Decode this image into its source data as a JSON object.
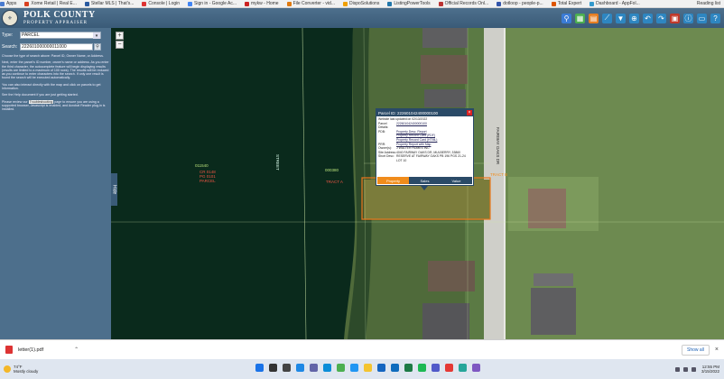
{
  "bookmarks": [
    {
      "label": "Apps",
      "color": "#4a7bd0"
    },
    {
      "label": "Xome Retail | Real E...",
      "color": "#d94020"
    },
    {
      "label": "Stellar MLS | That's...",
      "color": "#2a5aa0"
    },
    {
      "label": "Console | Login",
      "color": "#d33"
    },
    {
      "label": "Sign in - Google Ac...",
      "color": "#4285f4"
    },
    {
      "label": "mykw - Home",
      "color": "#c22"
    },
    {
      "label": "File Converter - vid...",
      "color": "#e07a10"
    },
    {
      "label": "DispoSolutions",
      "color": "#f0a000"
    },
    {
      "label": "ListingPowerTools",
      "color": "#27a"
    },
    {
      "label": "Official Records Onl...",
      "color": "#b33"
    },
    {
      "label": "dotloop - people-p...",
      "color": "#35a"
    },
    {
      "label": "Total Expert",
      "color": "#d50"
    },
    {
      "label": "Dashboard - AppFol...",
      "color": "#39c"
    }
  ],
  "reading_list": "Reading list",
  "header": {
    "title": "POLK COUNTY",
    "subtitle": "PROPERTY APPRAISER"
  },
  "toolbar_icons": [
    {
      "name": "binoculars-icon",
      "glyph": "⚲",
      "color": "#3a7bd5"
    },
    {
      "name": "grid-icon",
      "glyph": "▦",
      "color": "#4caf50"
    },
    {
      "name": "layers-icon",
      "glyph": "▤",
      "color": "#e67e22"
    },
    {
      "name": "measure-icon",
      "glyph": "⟋",
      "color": "#2e86c1"
    },
    {
      "name": "filter-icon",
      "glyph": "▼",
      "color": "#2e86c1"
    },
    {
      "name": "zoom-icon",
      "glyph": "⊕",
      "color": "#2e86c1"
    },
    {
      "name": "back-icon",
      "glyph": "↶",
      "color": "#2e86c1"
    },
    {
      "name": "forward-icon",
      "glyph": "↷",
      "color": "#2e86c1"
    },
    {
      "name": "print-icon",
      "glyph": "▣",
      "color": "#c0392b"
    },
    {
      "name": "info-icon",
      "glyph": "ⓘ",
      "color": "#2e86c1"
    },
    {
      "name": "export-icon",
      "glyph": "▭",
      "color": "#2e86c1"
    },
    {
      "name": "help-icon",
      "glyph": "?",
      "color": "#2e86c1"
    }
  ],
  "sidebar": {
    "type_label": "Type:",
    "type_value": "PARCEL",
    "search_label": "Search:",
    "search_value": "222601000000011000",
    "help_texts": [
      "Choose the type of search above: Parcel ID, Owner Name, or Address.",
      "Next, enter the parcel's ID number, owner's name or address. As you enter the third character, the autocomplete feature will begin displaying results (results are limited to a maximum of 100 rows). The results will be reduced as you continue to enter characters into the search. If only one result is found the search will be executed automatically.",
      "You can also interact directly with the map and click on parcels to get information.",
      "See the Help document if you are just getting started."
    ],
    "tshoot_prefix": "Please review our",
    "tshoot_link": "Troubleshooting",
    "tshoot_suffix": "page to ensure you are using a supported browser, Javascript is enabled, and Acrobat Reader plug-in is installed."
  },
  "hide_label": "Hide",
  "map_labels": {
    "parcel_a": "011540",
    "parcel_b": "000380",
    "red_a1": "CR 0148",
    "red_a2": "PG 0101",
    "red_a3": "PARCEL",
    "red_b": "TRACT A",
    "red_c": "TRACT B",
    "street_a": "STREET",
    "street_b": "FAIRWAY OAKS DR"
  },
  "popup": {
    "title": "Parcel ID: 222601042400000100",
    "updated": "Website last updated on 02/13/2022",
    "rows": [
      {
        "k": "Parcel Details:",
        "v": "222601042400000100",
        "link": true
      },
      {
        "k": "PDB:",
        "v": "Property Desc. Report",
        "link": true
      },
      {
        "k": "",
        "v": "Property Record Card (PDF)",
        "link": true
      },
      {
        "k": "",
        "v": "Property Record Card (HTML)",
        "link": true
      },
      {
        "k": "PRR:",
        "v": "Property Report with Map",
        "link": true
      },
      {
        "k": "Owner(s):",
        "v": "J WALTER HOMES INC",
        "link": false
      },
      {
        "k": "Site Address:",
        "v": "4040 FAIRWAY OAKS DR, MULBERRY, 33860",
        "link": false
      },
      {
        "k": "Short Desc:",
        "v": "RESERVE AT FAIRWAY OAKS PB 196 PGS 21-24 LOT 10",
        "link": false
      }
    ],
    "tabs": [
      "Property",
      "Sales",
      "Value"
    ]
  },
  "download": {
    "file": "letter(1).pdf",
    "show_all": "Show all"
  },
  "weather": {
    "temp": "74°F",
    "cond": "Mostly cloudy"
  },
  "taskbar_apps": [
    {
      "name": "windows-start-icon",
      "color": "#1a73e8"
    },
    {
      "name": "search-icon",
      "color": "#333"
    },
    {
      "name": "task-view-icon",
      "color": "#444"
    },
    {
      "name": "widgets-icon",
      "color": "#1e88e5"
    },
    {
      "name": "chat-icon",
      "color": "#6264a7"
    },
    {
      "name": "edge-icon",
      "color": "#0b8dd8"
    },
    {
      "name": "chrome-icon",
      "color": "#4caf50"
    },
    {
      "name": "store-icon",
      "color": "#2196f3"
    },
    {
      "name": "file-explorer-icon",
      "color": "#f4c430"
    },
    {
      "name": "mail-icon",
      "color": "#1565c0"
    },
    {
      "name": "outlook-icon",
      "color": "#0f6cbd"
    },
    {
      "name": "excel-icon",
      "color": "#1d7a45"
    },
    {
      "name": "spotify-icon",
      "color": "#1db954"
    },
    {
      "name": "teams-icon",
      "color": "#5059c9"
    },
    {
      "name": "chrome-2-icon",
      "color": "#e53935"
    },
    {
      "name": "app-icon",
      "color": "#26a69a"
    },
    {
      "name": "snip-icon",
      "color": "#7e57c2"
    }
  ],
  "clock": {
    "time": "12:55 PM",
    "date": "3/15/2022"
  }
}
